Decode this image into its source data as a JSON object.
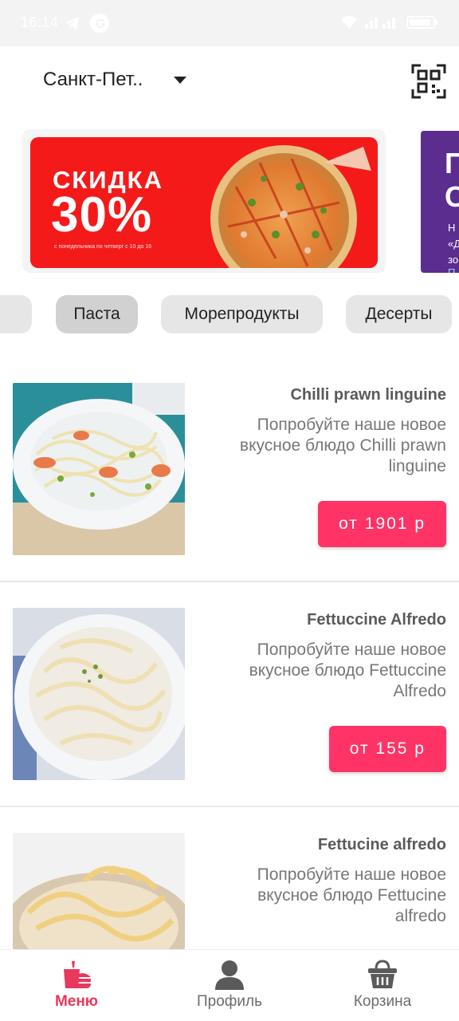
{
  "status_bar": {
    "time": "16:14"
  },
  "header": {
    "city": "Санкт-Пет..",
    "qr_icon": "qr-code-icon"
  },
  "banners": {
    "main": {
      "title": "СКИДКА",
      "percent": "30%",
      "note": "с понедельника по четверг с 10 до 16"
    },
    "second": {
      "big_text": "П\nС",
      "small_text": "Н\n«Д\nзо",
      "link_text": "П"
    }
  },
  "categories": {
    "items": [
      {
        "label": ""
      },
      {
        "label": "Паста",
        "active": true
      },
      {
        "label": "Морепродукты"
      },
      {
        "label": "Десерты"
      }
    ]
  },
  "products": [
    {
      "name": "Chilli prawn linguine",
      "description": "Попробуйте наше новое вкусное блюдо Chilli prawn linguine",
      "price": "от 1901 р"
    },
    {
      "name": "Fettuccine Alfredo",
      "description": "Попробуйте наше новое вкусное блюдо Fettuccine Alfredo",
      "price": "от 155 р"
    },
    {
      "name": "Fettucine alfredo",
      "description": "Попробуйте наше новое вкусное блюдо Fettucine alfredo",
      "price": ""
    }
  ],
  "bottom_nav": {
    "items": [
      {
        "label": "Меню",
        "icon": "fast-food-icon",
        "active": true
      },
      {
        "label": "Профиль",
        "icon": "person-icon"
      },
      {
        "label": "Корзина",
        "icon": "basket-icon"
      }
    ]
  },
  "colors": {
    "accent": "#ff3366",
    "nav_active": "#e8385d",
    "banner_red": "#f41a1a",
    "banner_purple": "#5b2d8e"
  }
}
